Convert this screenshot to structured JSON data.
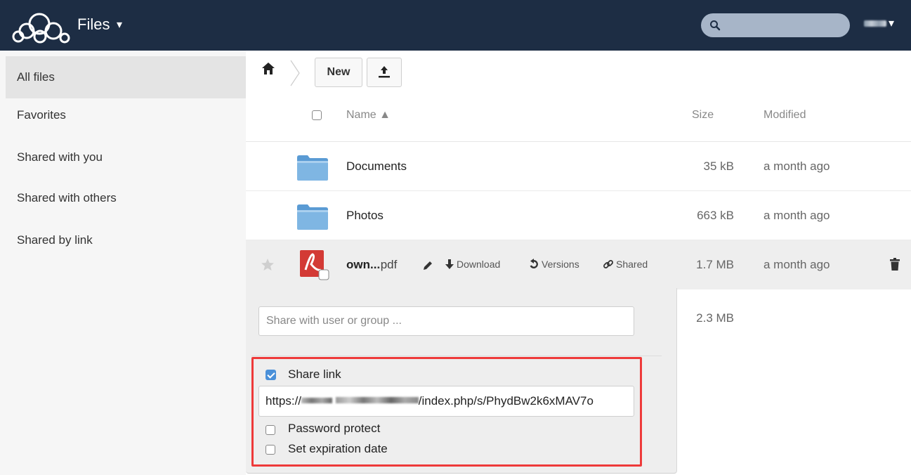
{
  "header": {
    "app_name": "Files",
    "app_caret": "▾",
    "user_caret": "▾",
    "logo_icon": "owncloud-cloud-logo",
    "search_icon": "search-icon"
  },
  "sidebar": {
    "items": [
      {
        "label": "All files",
        "active": true
      },
      {
        "label": "Favorites",
        "active": false
      },
      {
        "label": "Shared with you",
        "active": false
      },
      {
        "label": "Shared with others",
        "active": false
      },
      {
        "label": "Shared by link",
        "active": false
      }
    ]
  },
  "controls": {
    "new_label": "New",
    "home_icon": "home-icon",
    "upload_icon": "upload-icon"
  },
  "table": {
    "headers": {
      "name": "Name ▲",
      "size": "Size",
      "modified": "Modified"
    },
    "rows": [
      {
        "name": "Documents",
        "size": "35 kB",
        "modified": "a month ago",
        "type": "folder"
      },
      {
        "name": "Photos",
        "size": "663 kB",
        "modified": "a month ago",
        "type": "folder"
      },
      {
        "name_start": "own...",
        "name_ext": " .pdf",
        "size": "1.7 MB",
        "modified": "a month ago",
        "type": "pdf"
      }
    ],
    "file_actions": {
      "download": "Download",
      "versions": "Versions",
      "shared": "Shared"
    },
    "extra_size": "2.3 MB"
  },
  "share": {
    "input_placeholder": "Share with user or group ...",
    "share_link_label": "Share link",
    "share_link_checked": true,
    "link_prefix": "https://",
    "link_suffix": "/index.php/s/PhydBw2k6xMAV7o",
    "password_label": "Password protect",
    "expiration_label": "Set expiration date"
  },
  "colors": {
    "header_bg": "#1d2d44",
    "highlight": "#ee3a3a",
    "checkbox_blue": "#4a90d9"
  }
}
